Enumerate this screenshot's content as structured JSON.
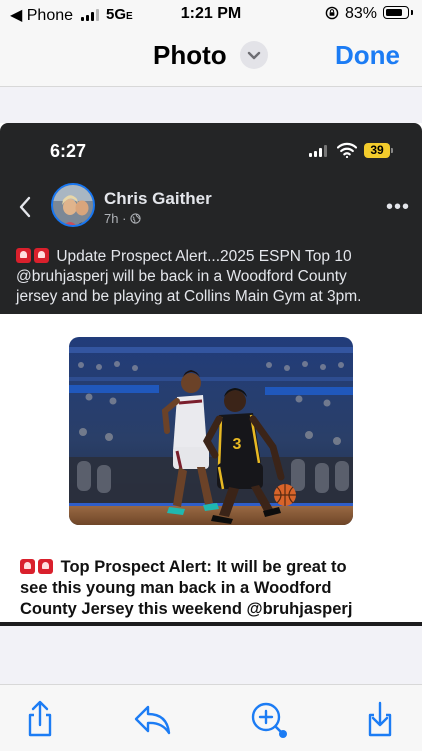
{
  "status_bar": {
    "back_label": "◀ Phone",
    "network": "5G",
    "network_suffix": "E",
    "time": "1:21 PM",
    "battery_percent": "83%",
    "battery_level": 0.83,
    "signal_bars": 3
  },
  "nav": {
    "title": "Photo",
    "done_label": "Done"
  },
  "inner_phone": {
    "time": "6:27",
    "battery": "39",
    "signal_bars": 3
  },
  "post": {
    "author": "Chris Gaither",
    "age": "7h",
    "meta_separator": "·",
    "more_label": "•••",
    "text_line1": "Update Prospect Alert...2025 ESPN Top 10",
    "text_line2": "@bruhjasperj will be back in a Woodford County",
    "text_line3": "jersey and be playing at Collins Main Gym at 3pm.",
    "caption_line1": "Top Prospect Alert:   It will be great to",
    "caption_line2": "see this young man back in a Woodford",
    "caption_line3": "County Jersey this weekend @bruhjasperj"
  },
  "photo": {
    "jersey_number": "3"
  },
  "colors": {
    "accent": "#1c7cf4",
    "dark_bg": "#242526",
    "fb_blue": "#1877f2",
    "alert_red": "#d9202c",
    "battery_yellow": "#f3cc2c"
  },
  "toolbar": {
    "icons": [
      "share-icon",
      "reply-icon",
      "markup-icon",
      "save-icon"
    ]
  }
}
